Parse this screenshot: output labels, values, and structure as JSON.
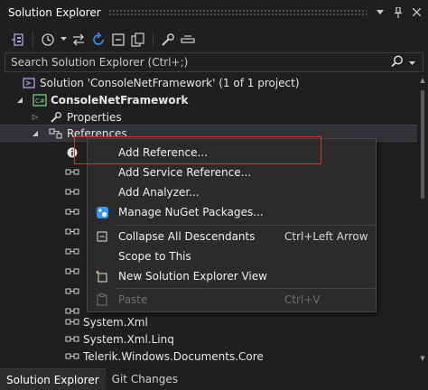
{
  "window": {
    "title": "Solution Explorer",
    "buttons": [
      {
        "name": "window-position-dropdown",
        "glyph": "▾"
      },
      {
        "name": "pin-button",
        "glyph": "⊥"
      },
      {
        "name": "close-button",
        "glyph": "✕"
      }
    ]
  },
  "toolbar": {
    "icons": [
      {
        "name": "switch-views-icon"
      },
      {
        "name": "pending-changes-filter-icon"
      },
      {
        "name": "dropdown-arrow-icon"
      },
      {
        "name": "sync-with-active-document-icon"
      },
      {
        "name": "refresh-icon"
      },
      {
        "name": "collapse-all-icon"
      },
      {
        "name": "show-all-files-icon"
      },
      {
        "name": "properties-wrench-icon"
      },
      {
        "name": "preview-selected-items-icon"
      }
    ]
  },
  "search": {
    "placeholder": "Search Solution Explorer (Ctrl+;)"
  },
  "tree": {
    "solution_label": "Solution 'ConsoleNetFramework' (1 of 1 project)",
    "project_label": "ConsoleNetFramework",
    "properties_label": "Properties",
    "references_label": "References",
    "visible_references": [
      "System.Xml",
      "System.Xml.Linq",
      "Telerik.Windows.Documents.Core"
    ]
  },
  "context_menu": {
    "items": [
      {
        "label": "Add Reference...",
        "shortcut": "",
        "icon": "",
        "disabled": false
      },
      {
        "label": "Add Service Reference...",
        "shortcut": "",
        "icon": "",
        "disabled": false
      },
      {
        "label": "Add Analyzer...",
        "shortcut": "",
        "icon": "",
        "disabled": false
      },
      {
        "label": "Manage NuGet Packages...",
        "shortcut": "",
        "icon": "nuget-icon",
        "disabled": false
      },
      {
        "label": "Collapse All Descendants",
        "shortcut": "Ctrl+Left Arrow",
        "icon": "collapse-icon",
        "disabled": false
      },
      {
        "label": "Scope to This",
        "shortcut": "",
        "icon": "",
        "disabled": false
      },
      {
        "label": "New Solution Explorer View",
        "shortcut": "",
        "icon": "new-view-icon",
        "disabled": false
      },
      {
        "label": "Paste",
        "shortcut": "Ctrl+V",
        "icon": "paste-icon",
        "disabled": true
      }
    ]
  },
  "bottom_tabs": [
    {
      "label": "Solution Explorer",
      "active": true
    },
    {
      "label": "Git Changes",
      "active": false
    }
  ],
  "colors": {
    "background": "#1f1f1f",
    "menu_background": "#2b2b2b",
    "highlight_box": "#d0322b",
    "accent_blue": "#3794ff"
  }
}
